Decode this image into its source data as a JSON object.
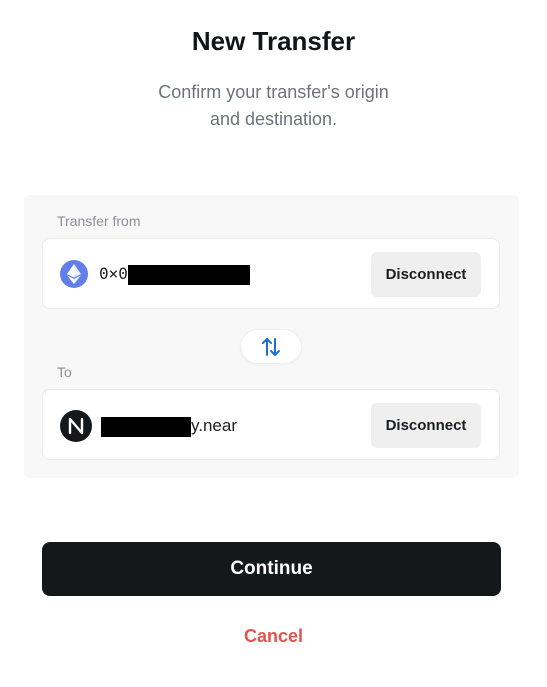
{
  "header": {
    "title": "New Transfer",
    "subtitle_line1": "Confirm your transfer's origin",
    "subtitle_line2": "and destination."
  },
  "from": {
    "label": "Transfer from",
    "icon": "ethereum-icon",
    "address_prefix": "0×0",
    "disconnect_label": "Disconnect"
  },
  "swap": {
    "icon": "swap-vertical-arrows-icon"
  },
  "to": {
    "label": "To",
    "icon": "near-icon",
    "address_suffix": "y.near",
    "disconnect_label": "Disconnect"
  },
  "actions": {
    "continue_label": "Continue",
    "cancel_label": "Cancel"
  },
  "colors": {
    "primary_button": "#15181b",
    "cancel_text": "#e5534b",
    "swap_arrows": "#1f6fd1",
    "ethereum": "#627eea"
  }
}
